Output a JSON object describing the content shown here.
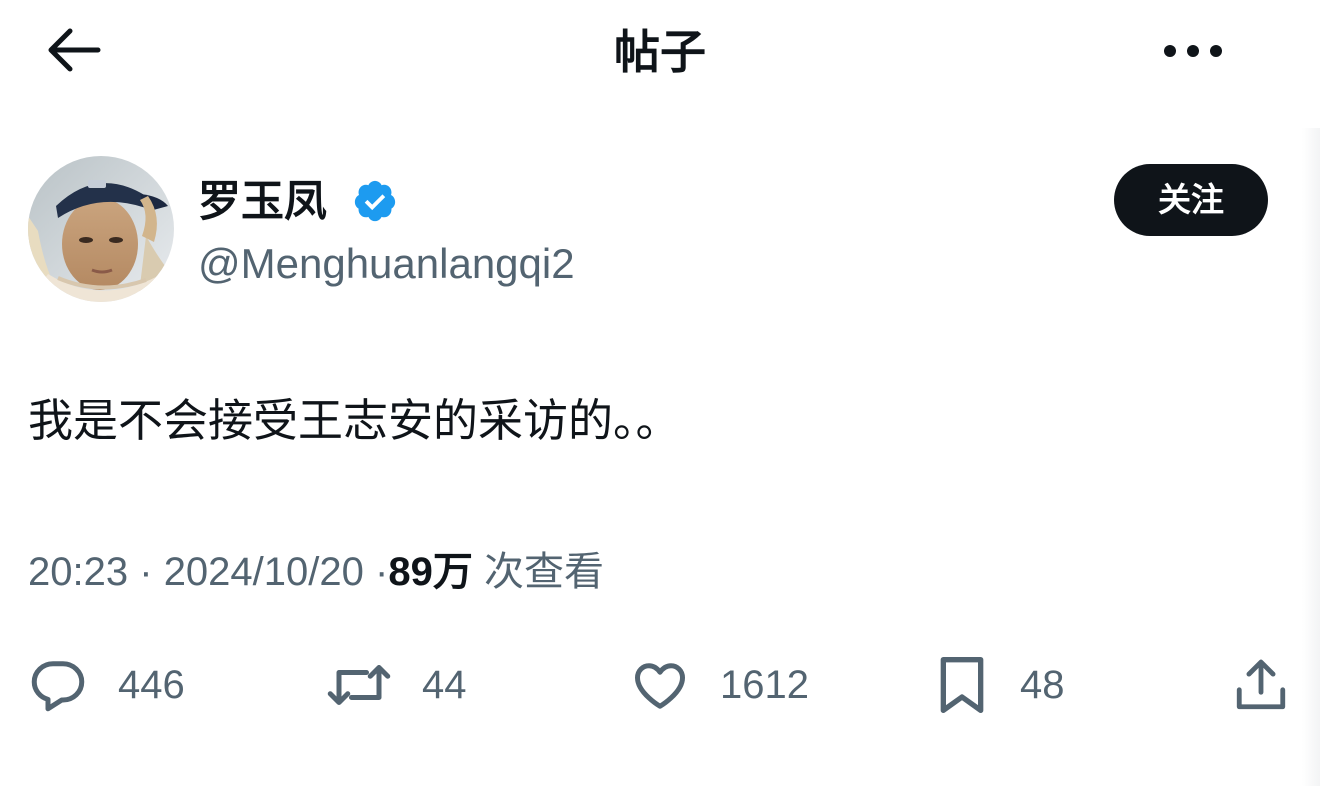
{
  "header": {
    "title": "帖子",
    "back_icon": "arrow-left-icon",
    "more_icon": "more-horizontal-icon"
  },
  "author": {
    "name": "罗玉凤",
    "handle": "@Menghuanlangqi2",
    "verified": true,
    "verified_color": "#1d9bf0",
    "follow_label": "关注"
  },
  "post": {
    "text": "我是不会接受王志安的采访的。。"
  },
  "meta": {
    "time": "20:23",
    "date": "2024/10/20",
    "separator": "·",
    "views_count": "89万",
    "views_label": "次查看"
  },
  "actions": {
    "replies": {
      "icon": "reply-icon",
      "count": "446"
    },
    "retweets": {
      "icon": "retweet-icon",
      "count": "44"
    },
    "likes": {
      "icon": "heart-icon",
      "count": "1612"
    },
    "bookmarks": {
      "icon": "bookmark-icon",
      "count": "48"
    },
    "share": {
      "icon": "share-icon"
    }
  },
  "colors": {
    "text_primary": "#0f1419",
    "text_secondary": "#536471",
    "accent": "#1d9bf0",
    "follow_bg": "#0f1419"
  }
}
